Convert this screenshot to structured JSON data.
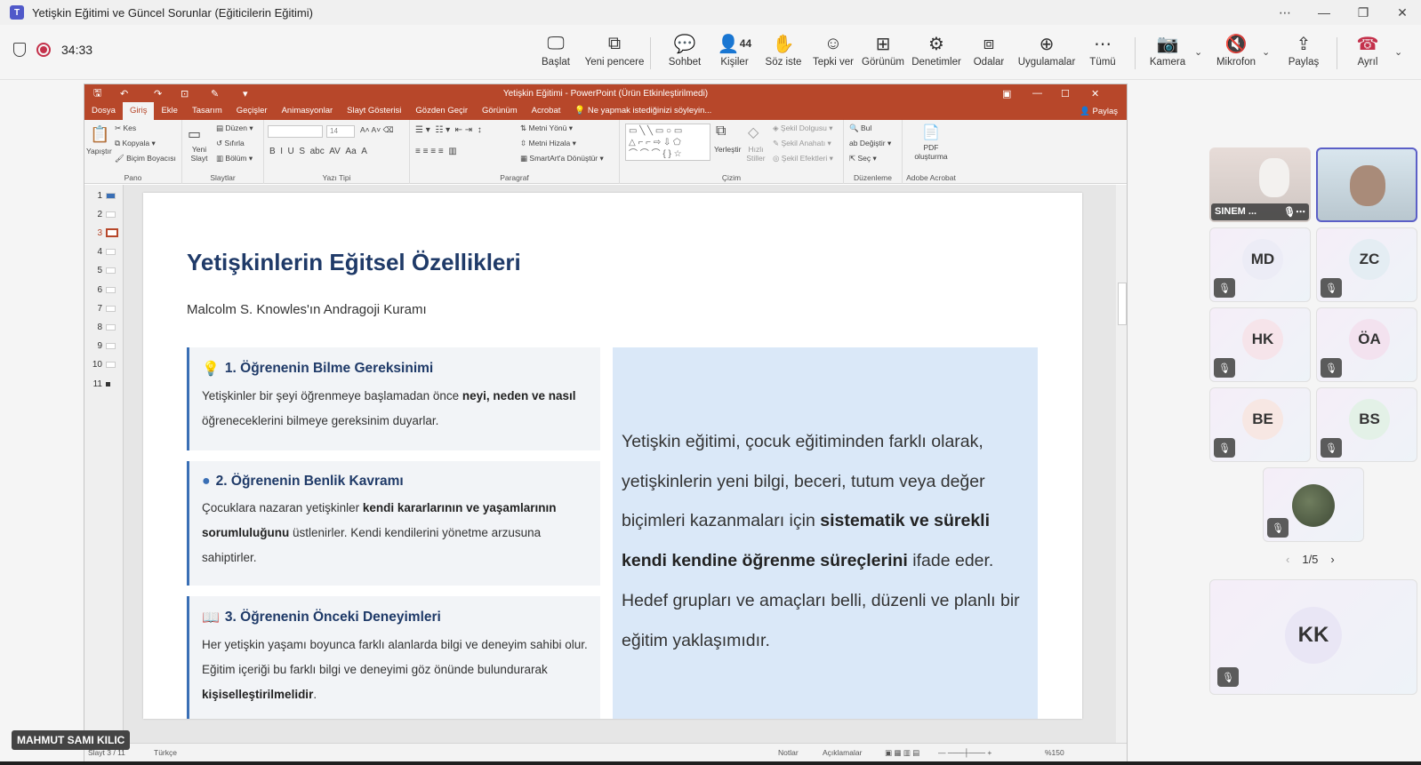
{
  "window": {
    "title": "Yetişkin Eğitimi ve Güncel Sorunlar (Eğiticilerin Eğitimi)",
    "app_icon": "T"
  },
  "meeting": {
    "timer": "34:33",
    "toolbar": {
      "start": "Başlat",
      "new_window": "Yeni pencere",
      "chat": "Sohbet",
      "people": "Kişiler",
      "people_count": "44",
      "raise": "Söz iste",
      "react": "Tepki ver",
      "view": "Görünüm",
      "controls": "Denetimler",
      "rooms": "Odalar",
      "apps": "Uygulamalar",
      "more": "Tümü",
      "camera": "Kamera",
      "mic": "Mikrofon",
      "share": "Paylaş",
      "leave": "Ayrıl"
    }
  },
  "ppt": {
    "title": "Yetişkin Eğitimi - PowerPoint (Ürün Etkinleştirilmedi)",
    "tabs": [
      "Dosya",
      "Giriş",
      "Ekle",
      "Tasarım",
      "Geçişler",
      "Animasyonlar",
      "Slayt Gösterisi",
      "Gözden Geçir",
      "Görünüm",
      "Acrobat"
    ],
    "tell_me": "Ne yapmak istediğinizi söyleyin...",
    "share": "Paylaş",
    "ribbon": {
      "paste": "Yapıştır",
      "cut": "Kes",
      "copy": "Kopyala",
      "format_painter": "Biçim Boyacısı",
      "group_clipboard": "Pano",
      "new_slide": "Yeni Slayt",
      "layout": "Düzen",
      "reset": "Sıfırla",
      "section": "Bölüm",
      "group_slides": "Slaytlar",
      "font_size": "14",
      "group_font": "Yazı Tipi",
      "text_direction": "Metni Yönü",
      "align_text": "Metni Hizala",
      "smartart": "SmartArt'a Dönüştür",
      "group_paragraph": "Paragraf",
      "arrange": "Yerleştir",
      "quick_styles": "Hızlı Stiller",
      "shape_fill": "Şekil Dolgusu",
      "shape_outline": "Şekil Anahatı",
      "shape_effects": "Şekil Efektleri",
      "group_drawing": "Çizim",
      "find": "Bul",
      "replace": "Değiştir",
      "select": "Seç",
      "group_editing": "Düzenleme",
      "pdf": "PDF oluşturma",
      "group_acrobat": "Adobe Acrobat"
    },
    "thumb_numbers": [
      "1",
      "2",
      "3",
      "4",
      "5",
      "6",
      "7",
      "8",
      "9",
      "10",
      "11"
    ],
    "status": {
      "slide": "Slayt 3 / 11",
      "language": "Türkçe",
      "notes": "Notlar",
      "comments": "Açıklamalar",
      "zoom": "%150"
    }
  },
  "slide": {
    "title": "Yetişkinlerin Eğitsel Özellikleri",
    "subtitle": "Malcolm S. Knowles'ın Andragoji Kuramı",
    "cards": [
      {
        "heading": "1. Öğrenenin Bilme Gereksinimi",
        "body_pre": "Yetişkinler bir şeyi öğrenmeye başlamadan önce ",
        "body_bold": "neyi, neden ve nasıl",
        "body_post": " öğreneceklerini bilmeye gereksinim duyarlar."
      },
      {
        "heading": "2. Öğrenenin Benlik Kavramı",
        "body_pre": "Çocuklara nazaran yetişkinler ",
        "body_bold": "kendi kararlarının ve yaşamlarının sorumluluğunu",
        "body_post": " üstlenirler. Kendi kendilerini yönetme arzusuna sahiptirler."
      },
      {
        "heading": "3. Öğrenenin Önceki Deneyimleri",
        "body_pre": "Her yetişkin yaşamı boyunca farklı alanlarda bilgi ve deneyim sahibi olur. Eğitim içeriği bu farklı bilgi ve deneyimi göz önünde bulundurarak ",
        "body_bold": "kişiselleştirilmelidir",
        "body_post": "."
      }
    ],
    "callout": {
      "pre": "Yetişkin eğitimi, çocuk eğitiminden farklı olarak, yetişkinlerin yeni bilgi, beceri, tutum veya değer biçimleri kazanmaları için ",
      "bold": "sistematik ve sürekli kendi kendine öğrenme süreçlerini",
      "post": " ifade eder. Hedef grupları ve amaçları belli, düzenli ve planlı bir eğitim yaklaşımıdır."
    }
  },
  "participants": {
    "sinem_label": "SINEM ...",
    "initials": [
      "MD",
      "ZC",
      "HK",
      "ÖA",
      "BE",
      "BS"
    ],
    "kk": "KK",
    "pager": "1/5",
    "presenter_name": "MAHMUT SAMI KILIC"
  },
  "colors": {
    "ppt_red": "#b7472a",
    "slide_title": "#1f3a68",
    "callout_bg": "#dae8f8",
    "record": "#c4314b"
  }
}
